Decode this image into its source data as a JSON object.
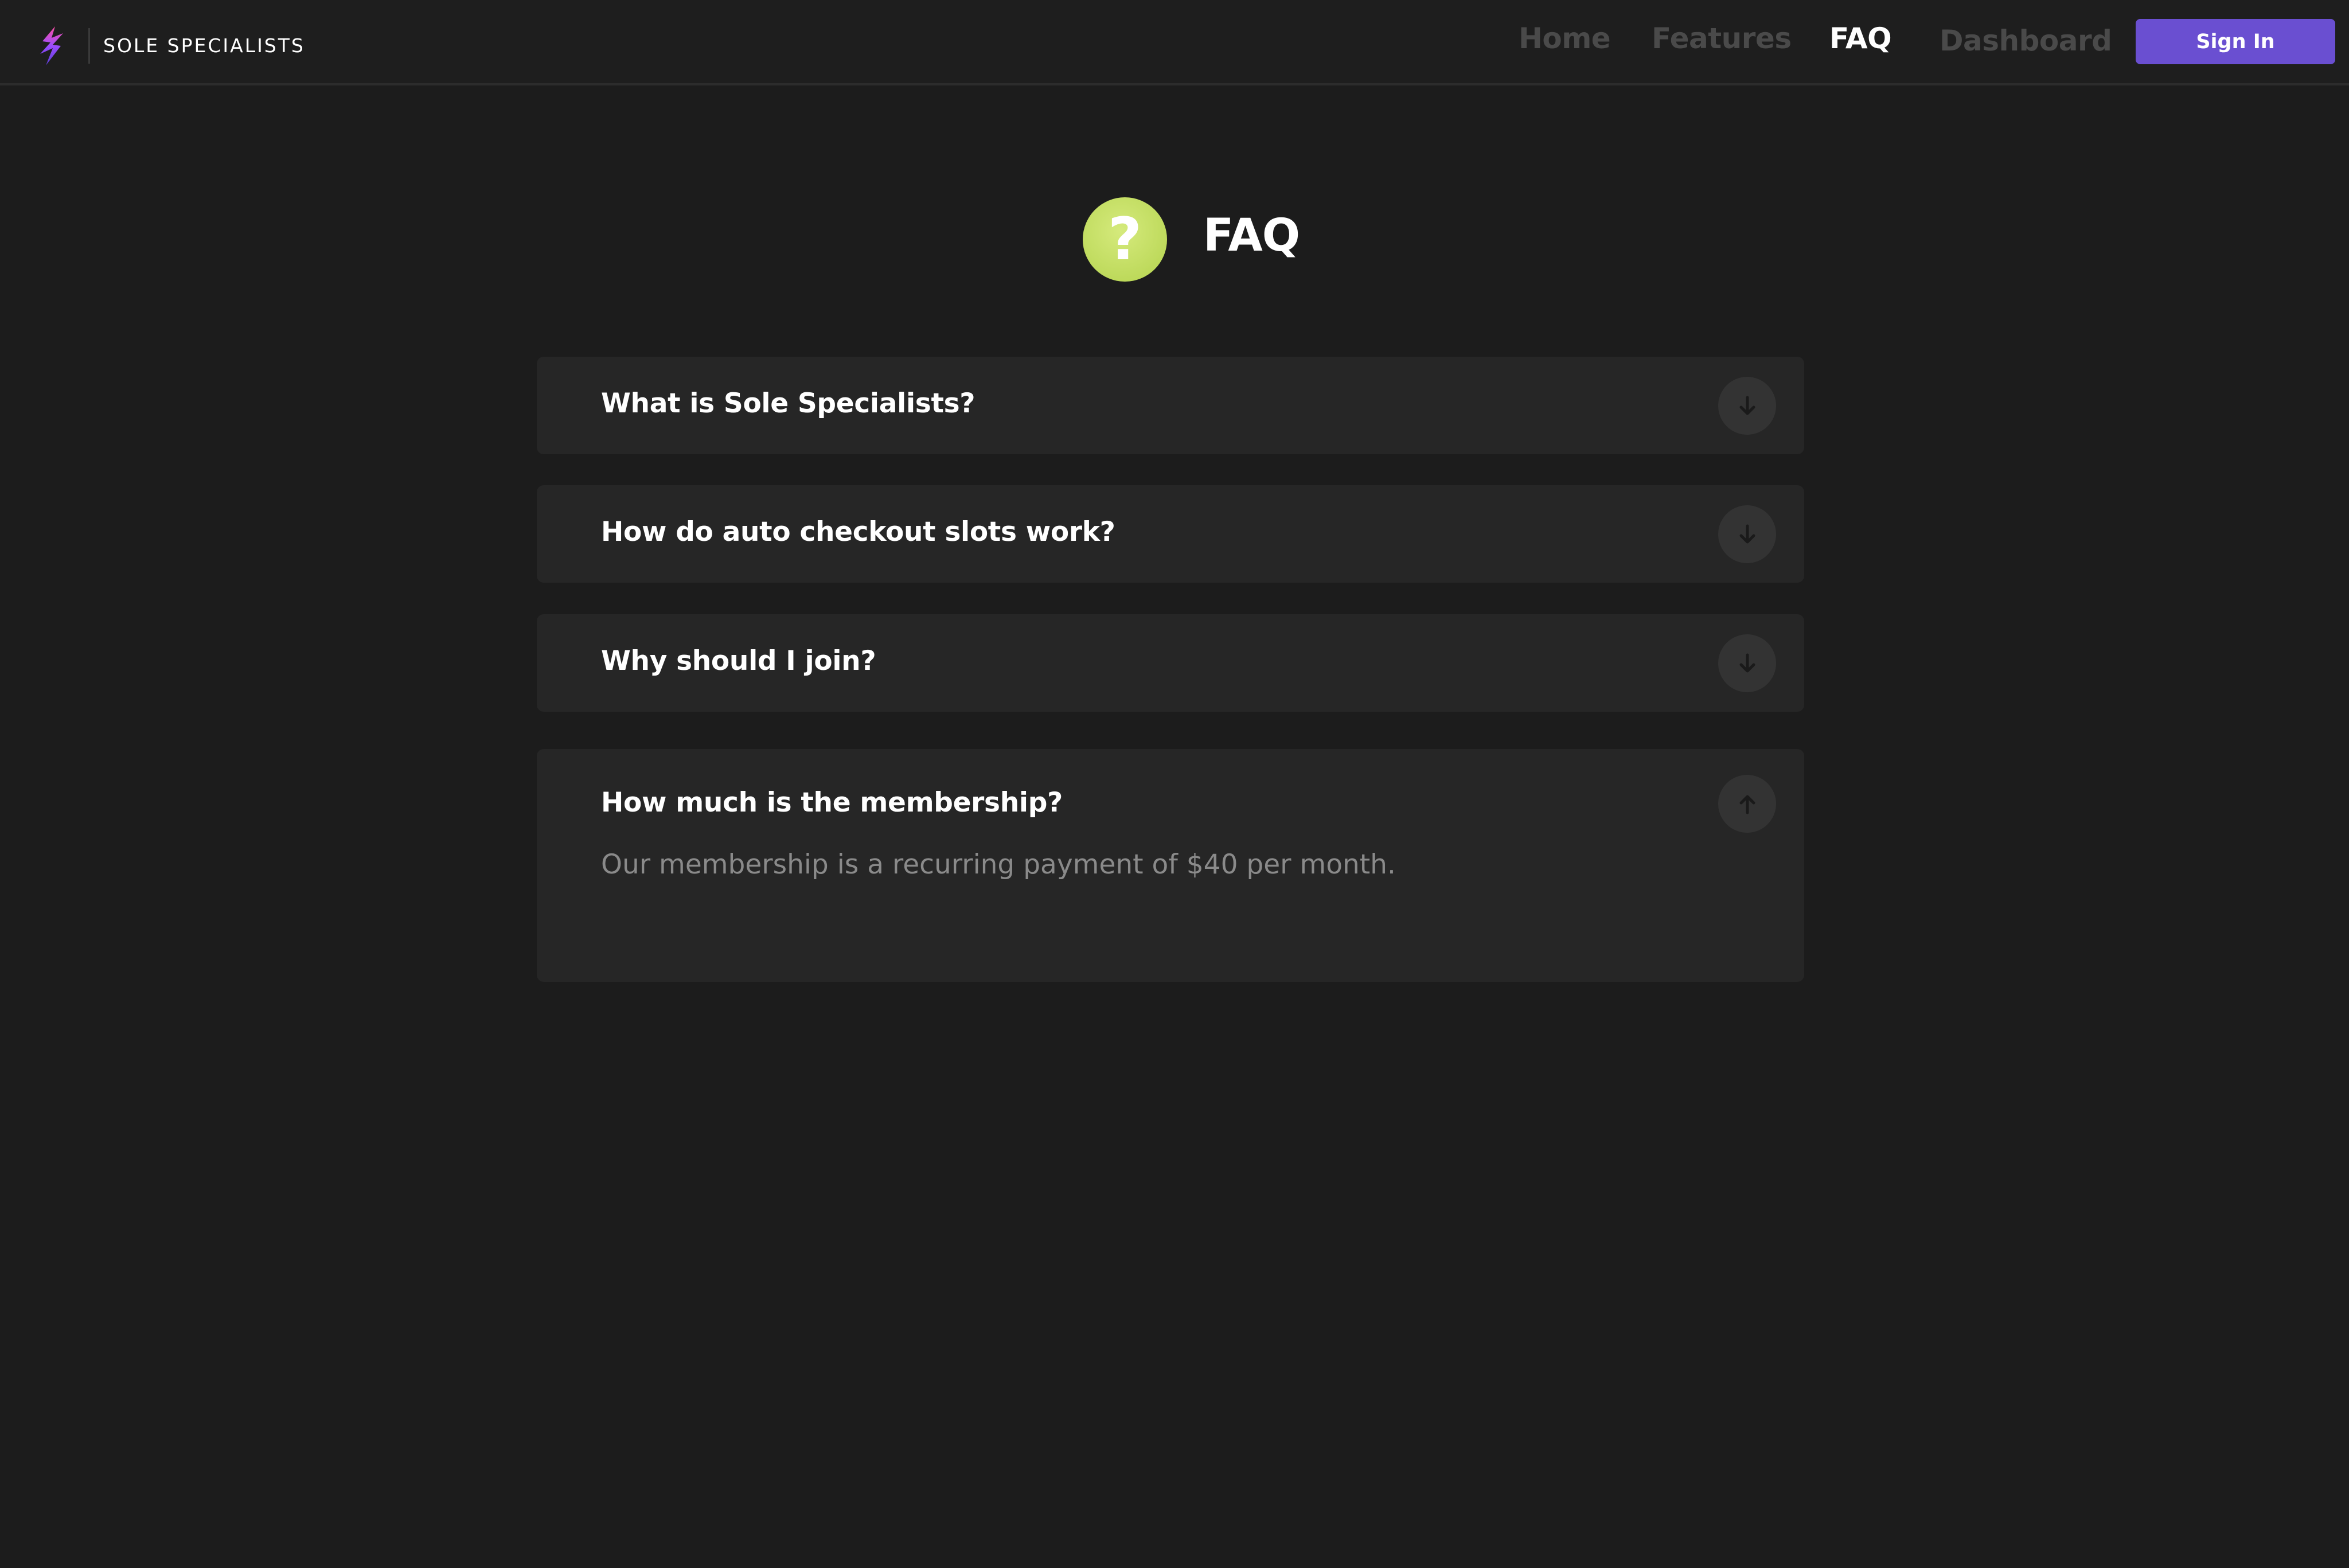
{
  "brand": {
    "name": "SOLE SPECIALISTS",
    "logo_icon": "flame-logo-icon"
  },
  "nav": {
    "links": [
      {
        "label": "Home",
        "active": false
      },
      {
        "label": "Features",
        "active": false
      },
      {
        "label": "FAQ",
        "active": true
      },
      {
        "label": "Dashboard",
        "active": false
      }
    ],
    "signin_label": "Sign In"
  },
  "page": {
    "title": "FAQ",
    "icon": "question-mark-icon",
    "icon_glyph": "?"
  },
  "faq": [
    {
      "question": "What is Sole Specialists?",
      "expanded": false,
      "toggle_icon": "arrow-down-icon"
    },
    {
      "question": "How do auto checkout slots work?",
      "expanded": false,
      "toggle_icon": "arrow-down-icon"
    },
    {
      "question": "Why should I join?",
      "expanded": false,
      "toggle_icon": "arrow-down-icon"
    },
    {
      "question": "How much is the membership?",
      "expanded": true,
      "toggle_icon": "arrow-up-icon",
      "answer": "Our membership is a recurring payment of $40 per month."
    }
  ],
  "colors": {
    "background": "#1c1c1c",
    "card": "#262626",
    "accent_button": "#6a4fd1",
    "faq_icon": "#c6e064",
    "inactive_nav": "#4a4a4a",
    "answer_text": "#8a8a8a"
  }
}
